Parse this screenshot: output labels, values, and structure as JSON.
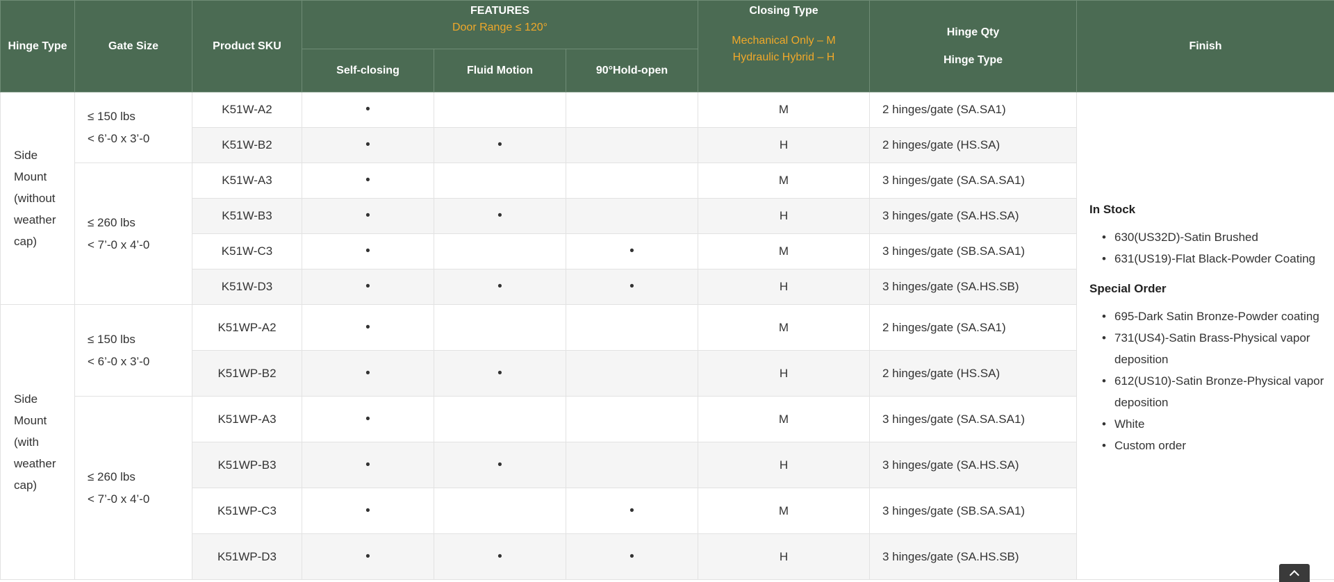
{
  "header": {
    "hinge_type": "Hinge Type",
    "gate_size": "Gate Size",
    "product_sku": "Product SKU",
    "features": "FEATURES",
    "door_range": "Door Range ≤ 120°",
    "self_closing": "Self-closing",
    "fluid_motion": "Fluid Motion",
    "hold_open": "90°Hold-open",
    "closing_type": "Closing Type",
    "closing_m": "Mechanical Only – M",
    "closing_h": "Hydraulic Hybrid – H",
    "hinge_qty": "Hinge Qty",
    "hinge_type_2": "Hinge Type",
    "finish": "Finish"
  },
  "groups": [
    {
      "hinge_type": "Side Mount (without weather cap)"
    },
    {
      "hinge_type": "Side Mount (with weather cap)"
    }
  ],
  "gates": [
    {
      "weight": "≤ 150 lbs",
      "size": "< 6’-0 x 3’-0"
    },
    {
      "weight": "≤ 260 lbs",
      "size": "< 7’-0 x 4’-0"
    },
    {
      "weight": "≤ 150 lbs",
      "size": "< 6’-0 x 3’-0"
    },
    {
      "weight": "≤ 260 lbs",
      "size": "< 7’-0 x 4’-0"
    }
  ],
  "bullet": "•",
  "rows": [
    {
      "sku": "K51W-A2",
      "type": "M",
      "qty": "2 hinges/gate (SA.SA1)"
    },
    {
      "sku": "K51W-B2",
      "type": "H",
      "qty": "2 hinges/gate (HS.SA)"
    },
    {
      "sku": "K51W-A3",
      "type": "M",
      "qty": "3 hinges/gate (SA.SA.SA1)"
    },
    {
      "sku": "K51W-B3",
      "type": "H",
      "qty": "3 hinges/gate (SA.HS.SA)"
    },
    {
      "sku": "K51W-C3",
      "type": "M",
      "qty": "3 hinges/gate (SB.SA.SA1)"
    },
    {
      "sku": "K51W-D3",
      "type": "H",
      "qty": "3 hinges/gate (SA.HS.SB)"
    },
    {
      "sku": "K51WP-A2",
      "type": "M",
      "qty": "2 hinges/gate (SA.SA1)"
    },
    {
      "sku": "K51WP-B2",
      "type": "H",
      "qty": "2 hinges/gate (HS.SA)"
    },
    {
      "sku": "K51WP-A3",
      "type": "M",
      "qty": "3 hinges/gate (SA.SA.SA1)"
    },
    {
      "sku": "K51WP-B3",
      "type": "H",
      "qty": "3 hinges/gate (SA.HS.SA)"
    },
    {
      "sku": "K51WP-C3",
      "type": "M",
      "qty": "3 hinges/gate (SB.SA.SA1)"
    },
    {
      "sku": "K51WP-D3",
      "type": "H",
      "qty": "3 hinges/gate (SA.HS.SB)"
    }
  ],
  "finish": {
    "in_stock_title": "In Stock",
    "in_stock": [
      "630(US32D)-Satin Brushed",
      "631(US19)-Flat Black-Powder Coating"
    ],
    "special_title": "Special Order",
    "special": [
      "695-Dark Satin Bronze-Powder coating",
      "731(US4)-Satin Brass-Physical vapor deposition",
      "612(US10)-Satin Bronze-Physical vapor deposition",
      "White",
      "Custom order"
    ]
  },
  "colors": {
    "header_bg": "#4b6b53",
    "accent": "#f0a82a"
  },
  "icons": {
    "scroll_top": "chevron-up-icon"
  }
}
